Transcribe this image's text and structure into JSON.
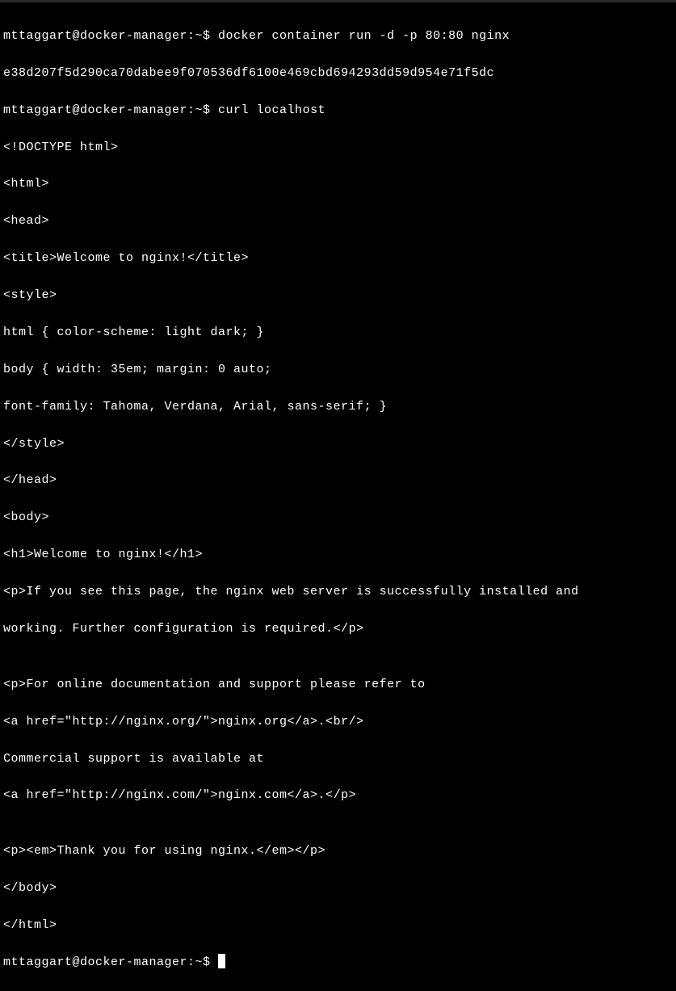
{
  "prompts": {
    "p1": "mttaggart@docker-manager:~$ ",
    "p2": "mttaggart@docker-manager:~$ ",
    "p3": "mttaggart@docker-manager:~$ "
  },
  "commands": {
    "cmd1": "docker container run -d -p 80:80 nginx",
    "cmd2": "curl localhost"
  },
  "output": {
    "container_id": "e38d207f5d290ca70dabee9f070536df6100e469cbd694293dd59d954e71f5dc",
    "html_lines": [
      "<!DOCTYPE html>",
      "<html>",
      "<head>",
      "<title>Welcome to nginx!</title>",
      "<style>",
      "html { color-scheme: light dark; }",
      "body { width: 35em; margin: 0 auto;",
      "font-family: Tahoma, Verdana, Arial, sans-serif; }",
      "</style>",
      "</head>",
      "<body>",
      "<h1>Welcome to nginx!</h1>",
      "<p>If you see this page, the nginx web server is successfully installed and",
      "working. Further configuration is required.</p>",
      "",
      "<p>For online documentation and support please refer to",
      "<a href=\"http://nginx.org/\">nginx.org</a>.<br/>",
      "Commercial support is available at",
      "<a href=\"http://nginx.com/\">nginx.com</a>.</p>",
      "",
      "<p><em>Thank you for using nginx.</em></p>",
      "</body>",
      "</html>"
    ]
  }
}
